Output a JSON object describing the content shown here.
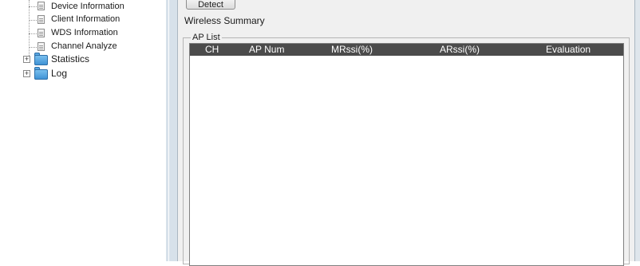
{
  "tree": {
    "items": [
      {
        "label": "Device Information"
      },
      {
        "label": "Client Information"
      },
      {
        "label": "WDS Information"
      },
      {
        "label": "Channel Analyze"
      }
    ],
    "folders": [
      {
        "label": "Statistics",
        "expander": "+"
      },
      {
        "label": "Log",
        "expander": "+"
      }
    ]
  },
  "toolbar": {
    "detect_label": "Detect"
  },
  "summary": {
    "title": "Wireless Summary",
    "ap_list_label": "AP List",
    "columns": [
      "CH",
      "AP Num",
      "MRssi(%)",
      "ARssi(%)",
      "Evaluation"
    ],
    "rows": []
  },
  "colors": {
    "header_bg": "#4b4b4b",
    "content_bg": "#f0f0f0",
    "splitter": "#d7e1ea",
    "folder": "#3b8fd3"
  }
}
